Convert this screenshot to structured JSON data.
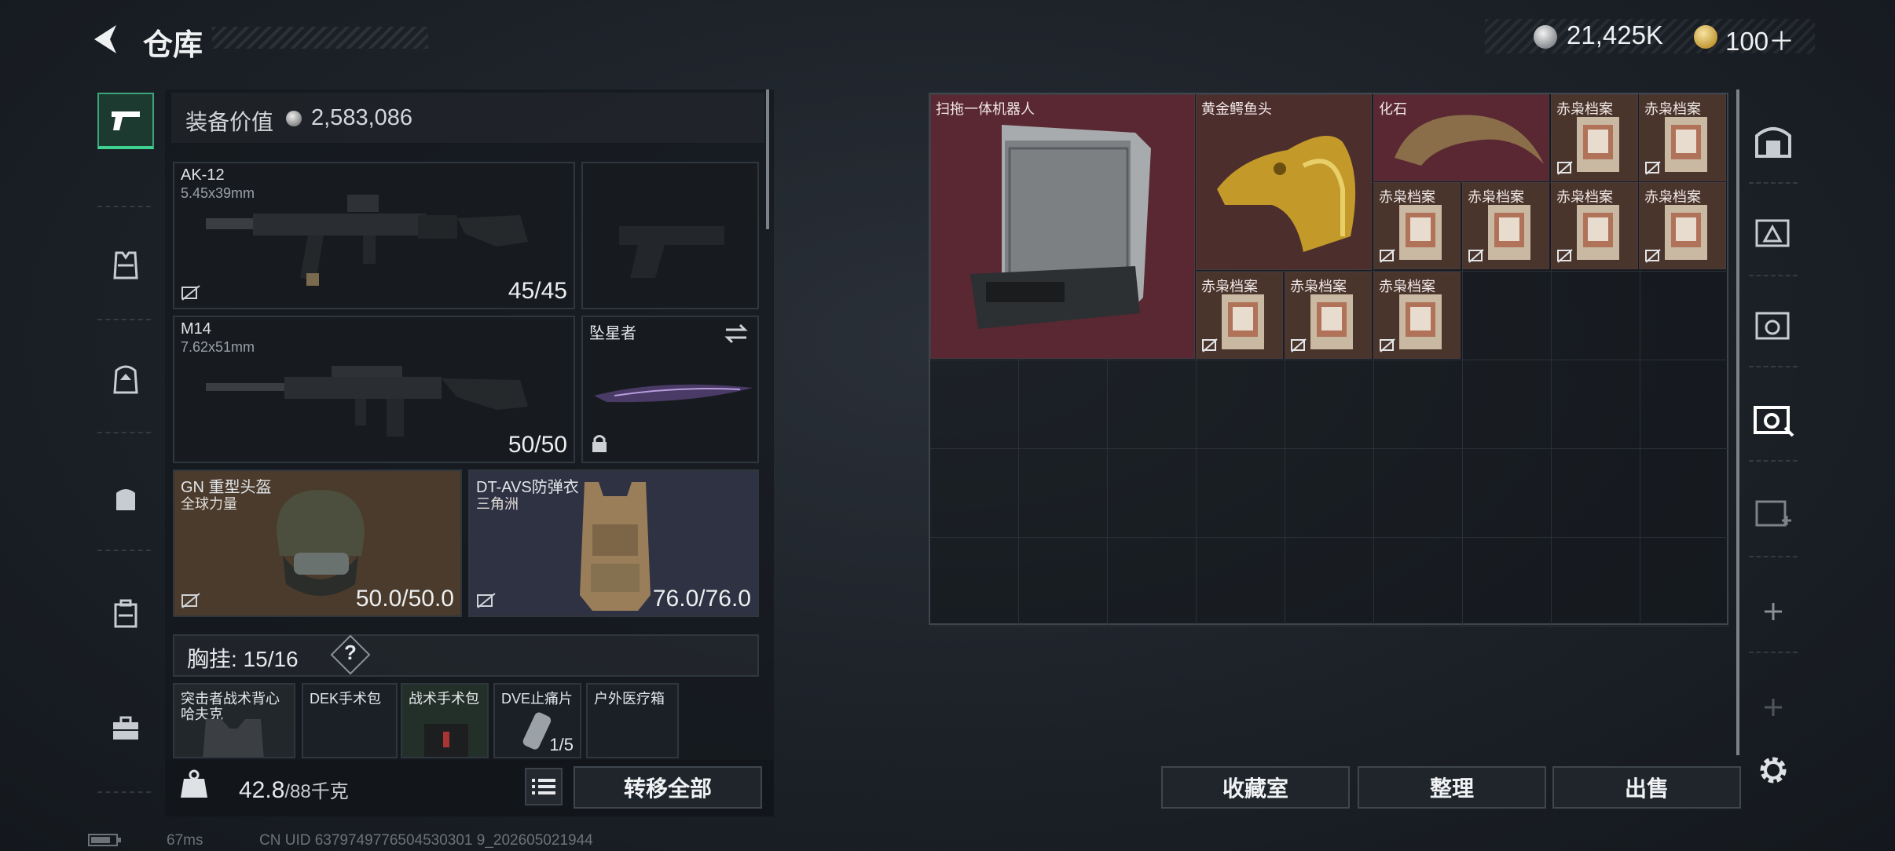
{
  "header": {
    "title": "仓库",
    "silver_amount": "21,425K",
    "gold_amount": "100＋"
  },
  "nav": {
    "items": [
      "weapons",
      "vest",
      "backpack",
      "bag",
      "container",
      "toolbox"
    ]
  },
  "equipment": {
    "value_label": "装备价值",
    "value": "2,583,086",
    "primary": {
      "name": "AK-12",
      "caliber": "5.45x39mm",
      "ammo": "45/45"
    },
    "secondary": {
      "name": "M14",
      "caliber": "7.62x51mm",
      "ammo": "50/50"
    },
    "melee": {
      "name": "坠星者"
    },
    "helmet": {
      "name": "GN 重型头盔",
      "sub": "全球力量",
      "durability": "50.0/50.0"
    },
    "armor": {
      "name": "DT-AVS防弹衣",
      "sub": "三角洲",
      "durability": "76.0/76.0"
    }
  },
  "chest_rig": {
    "label": "胸挂: 15/16",
    "help": "?",
    "items": [
      {
        "name": "突击者战术背心",
        "sub": "哈夫克"
      },
      {
        "name": "DEK手术包"
      },
      {
        "name": "战术手术包"
      },
      {
        "name": "DVE止痛片",
        "count": "1/5"
      },
      {
        "name": "户外医疗箱"
      }
    ]
  },
  "weight": {
    "value": "42.8",
    "max_unit": "/88千克"
  },
  "buttons": {
    "transfer_all": "转移全部",
    "collection": "收藏室",
    "organize": "整理",
    "sell": "出售"
  },
  "stash_items": {
    "robot": "扫拖一体机器人",
    "croc": "黄金鳄鱼头",
    "fossil": "化石",
    "file": "赤枭档案"
  },
  "footer": {
    "ping": "67ms",
    "uid": "CN UID 6379749776504530301 9_202605021944"
  }
}
